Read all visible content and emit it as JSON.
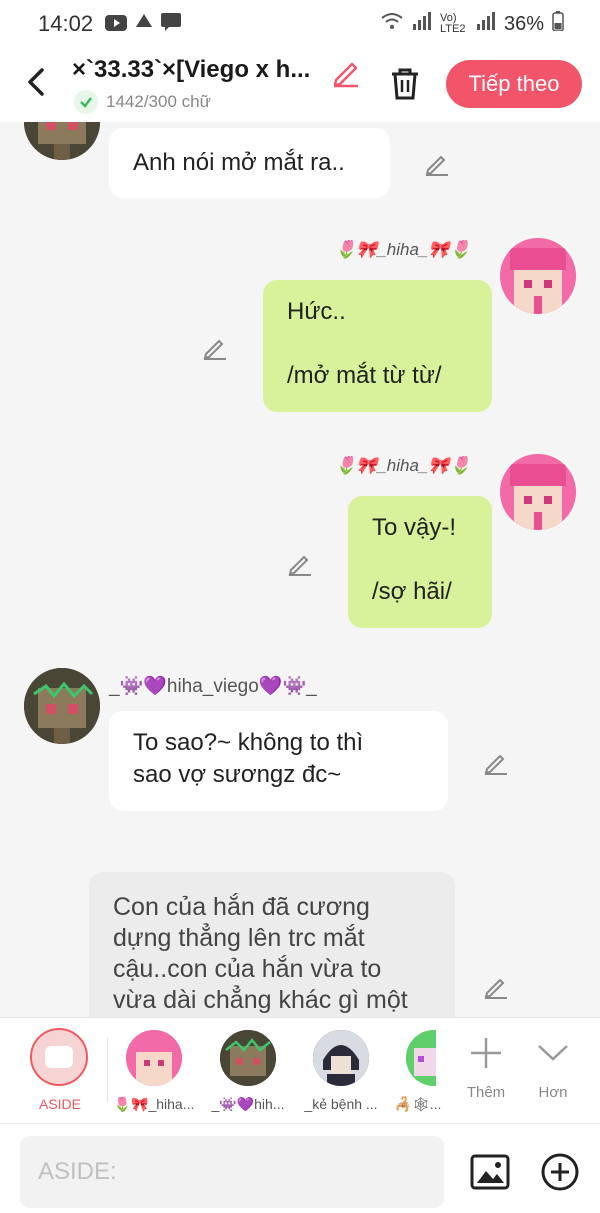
{
  "status": {
    "time": "14:02",
    "battery": "36%",
    "network": "Vo) LTE2"
  },
  "header": {
    "title": "×`33.33`×[Viego x h...",
    "word_count": "1442/300 chữ",
    "next_label": "Tiếp theo",
    "accent": "#f2546a"
  },
  "messages": [
    {
      "side": "left",
      "text": "Anh nói mở mắt ra.."
    },
    {
      "side": "right",
      "user": "🌷🎀_hiha_🎀🌷",
      "text": "Hức..\n\n/mở mắt từ từ/"
    },
    {
      "side": "right",
      "user": "🌷🎀_hiha_🎀🌷",
      "text": "To vậy-!\n\n/sợ hãi/"
    },
    {
      "side": "left",
      "user": "_👾💜hiha_viego💜👾_",
      "text": "To sao?~ không to thì\nsao vợ sươngz đc~"
    },
    {
      "side": "aside",
      "text": "Con của hắn đã cương\ndựng thẳng lên trc mắt\ncậu..con của hắn vừa to\nvừa dài chẳng khác gì một"
    }
  ],
  "strip": {
    "aside_label": "ASIDE",
    "characters": [
      {
        "label": "🌷🎀_hiha..."
      },
      {
        "label": "_👾💜hih..."
      },
      {
        "label": "_kẻ bệnh ..."
      },
      {
        "label": "🦂🕸..."
      }
    ],
    "add_label": "Thêm",
    "more_label": "Hơn"
  },
  "input": {
    "placeholder": "ASIDE:"
  },
  "colors": {
    "right_bubble": "#d7f29a",
    "left_bubble": "#ffffff",
    "aside_bubble": "#ececec",
    "aside_accent": "#f0595f"
  }
}
